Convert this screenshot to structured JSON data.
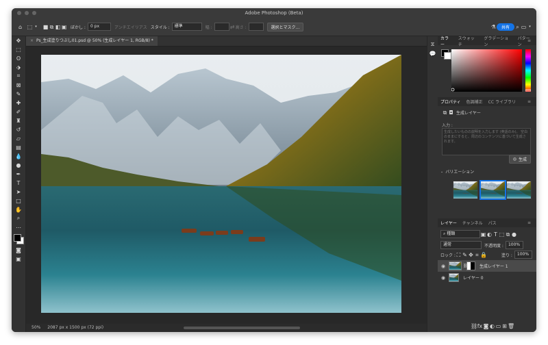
{
  "window": {
    "title": "Adobe Photoshop (Beta)"
  },
  "options": {
    "feather_label": "ぼかし :",
    "feather_value": "0 px",
    "antialias": "アンチエイリアス",
    "style_label": "スタイル :",
    "style_value": "標準",
    "width_label": "幅 :",
    "height_label": "高さ :",
    "select_mask": "選択とマスク...",
    "share": "共有"
  },
  "document": {
    "tab_title": "Ps_生成塗りつぶし01.psd @ 50% (生成レイヤー 1, RGB/8) *",
    "zoom": "50%",
    "doc_info": "2087 px x 1500 px (72 ppi)"
  },
  "color_panel": {
    "tabs": [
      "カラー",
      "スウォッチ",
      "グラデーション",
      "パターン"
    ],
    "hue_color": "#ff0000"
  },
  "properties": {
    "tabs": [
      "プロパティ",
      "色調補正",
      "CC ライブラリ"
    ],
    "layer_type": "生成レイヤー",
    "input_label": "入力 :",
    "placeholder": "生成したいものの説明を入力します (英語のみ)。 空白のままにすると、周辺のコンテンツに基づいて生成されます。",
    "generate": "生成",
    "variations_label": "バリエーション"
  },
  "layers": {
    "tabs": [
      "レイヤー",
      "チャンネル",
      "パス"
    ],
    "filter_kind": "種類",
    "blend_mode": "通常",
    "opacity_label": "不透明度 :",
    "opacity_value": "100%",
    "lock_label": "ロック :",
    "fill_label": "塗り :",
    "fill_value": "100%",
    "items": [
      {
        "name": "生成レイヤー 1",
        "selected": true
      },
      {
        "name": "レイヤー 0",
        "selected": false
      }
    ]
  },
  "colors": {
    "accent": "#1473e6",
    "panel_bg": "#323232",
    "bar_bg": "#3a3a3a"
  }
}
